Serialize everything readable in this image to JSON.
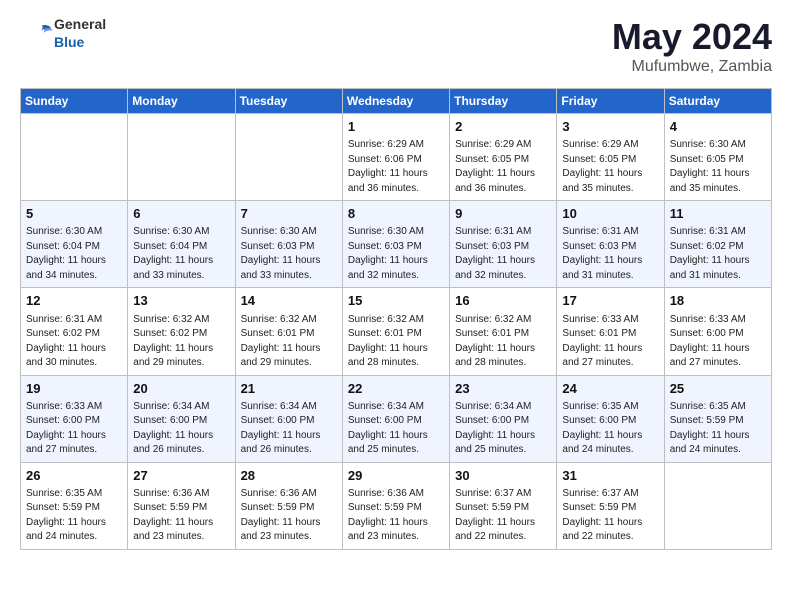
{
  "header": {
    "logo_general": "General",
    "logo_blue": "Blue",
    "month_year": "May 2024",
    "location": "Mufumbwe, Zambia"
  },
  "days_of_week": [
    "Sunday",
    "Monday",
    "Tuesday",
    "Wednesday",
    "Thursday",
    "Friday",
    "Saturday"
  ],
  "weeks": [
    {
      "row_class": "row-norm",
      "days": [
        {
          "num": "",
          "info": ""
        },
        {
          "num": "",
          "info": ""
        },
        {
          "num": "",
          "info": ""
        },
        {
          "num": "1",
          "info": "Sunrise: 6:29 AM\nSunset: 6:06 PM\nDaylight: 11 hours and 36 minutes."
        },
        {
          "num": "2",
          "info": "Sunrise: 6:29 AM\nSunset: 6:05 PM\nDaylight: 11 hours and 36 minutes."
        },
        {
          "num": "3",
          "info": "Sunrise: 6:29 AM\nSunset: 6:05 PM\nDaylight: 11 hours and 35 minutes."
        },
        {
          "num": "4",
          "info": "Sunrise: 6:30 AM\nSunset: 6:05 PM\nDaylight: 11 hours and 35 minutes."
        }
      ]
    },
    {
      "row_class": "row-alt",
      "days": [
        {
          "num": "5",
          "info": "Sunrise: 6:30 AM\nSunset: 6:04 PM\nDaylight: 11 hours and 34 minutes."
        },
        {
          "num": "6",
          "info": "Sunrise: 6:30 AM\nSunset: 6:04 PM\nDaylight: 11 hours and 33 minutes."
        },
        {
          "num": "7",
          "info": "Sunrise: 6:30 AM\nSunset: 6:03 PM\nDaylight: 11 hours and 33 minutes."
        },
        {
          "num": "8",
          "info": "Sunrise: 6:30 AM\nSunset: 6:03 PM\nDaylight: 11 hours and 32 minutes."
        },
        {
          "num": "9",
          "info": "Sunrise: 6:31 AM\nSunset: 6:03 PM\nDaylight: 11 hours and 32 minutes."
        },
        {
          "num": "10",
          "info": "Sunrise: 6:31 AM\nSunset: 6:03 PM\nDaylight: 11 hours and 31 minutes."
        },
        {
          "num": "11",
          "info": "Sunrise: 6:31 AM\nSunset: 6:02 PM\nDaylight: 11 hours and 31 minutes."
        }
      ]
    },
    {
      "row_class": "row-norm",
      "days": [
        {
          "num": "12",
          "info": "Sunrise: 6:31 AM\nSunset: 6:02 PM\nDaylight: 11 hours and 30 minutes."
        },
        {
          "num": "13",
          "info": "Sunrise: 6:32 AM\nSunset: 6:02 PM\nDaylight: 11 hours and 29 minutes."
        },
        {
          "num": "14",
          "info": "Sunrise: 6:32 AM\nSunset: 6:01 PM\nDaylight: 11 hours and 29 minutes."
        },
        {
          "num": "15",
          "info": "Sunrise: 6:32 AM\nSunset: 6:01 PM\nDaylight: 11 hours and 28 minutes."
        },
        {
          "num": "16",
          "info": "Sunrise: 6:32 AM\nSunset: 6:01 PM\nDaylight: 11 hours and 28 minutes."
        },
        {
          "num": "17",
          "info": "Sunrise: 6:33 AM\nSunset: 6:01 PM\nDaylight: 11 hours and 27 minutes."
        },
        {
          "num": "18",
          "info": "Sunrise: 6:33 AM\nSunset: 6:00 PM\nDaylight: 11 hours and 27 minutes."
        }
      ]
    },
    {
      "row_class": "row-alt",
      "days": [
        {
          "num": "19",
          "info": "Sunrise: 6:33 AM\nSunset: 6:00 PM\nDaylight: 11 hours and 27 minutes."
        },
        {
          "num": "20",
          "info": "Sunrise: 6:34 AM\nSunset: 6:00 PM\nDaylight: 11 hours and 26 minutes."
        },
        {
          "num": "21",
          "info": "Sunrise: 6:34 AM\nSunset: 6:00 PM\nDaylight: 11 hours and 26 minutes."
        },
        {
          "num": "22",
          "info": "Sunrise: 6:34 AM\nSunset: 6:00 PM\nDaylight: 11 hours and 25 minutes."
        },
        {
          "num": "23",
          "info": "Sunrise: 6:34 AM\nSunset: 6:00 PM\nDaylight: 11 hours and 25 minutes."
        },
        {
          "num": "24",
          "info": "Sunrise: 6:35 AM\nSunset: 6:00 PM\nDaylight: 11 hours and 24 minutes."
        },
        {
          "num": "25",
          "info": "Sunrise: 6:35 AM\nSunset: 5:59 PM\nDaylight: 11 hours and 24 minutes."
        }
      ]
    },
    {
      "row_class": "row-norm",
      "days": [
        {
          "num": "26",
          "info": "Sunrise: 6:35 AM\nSunset: 5:59 PM\nDaylight: 11 hours and 24 minutes."
        },
        {
          "num": "27",
          "info": "Sunrise: 6:36 AM\nSunset: 5:59 PM\nDaylight: 11 hours and 23 minutes."
        },
        {
          "num": "28",
          "info": "Sunrise: 6:36 AM\nSunset: 5:59 PM\nDaylight: 11 hours and 23 minutes."
        },
        {
          "num": "29",
          "info": "Sunrise: 6:36 AM\nSunset: 5:59 PM\nDaylight: 11 hours and 23 minutes."
        },
        {
          "num": "30",
          "info": "Sunrise: 6:37 AM\nSunset: 5:59 PM\nDaylight: 11 hours and 22 minutes."
        },
        {
          "num": "31",
          "info": "Sunrise: 6:37 AM\nSunset: 5:59 PM\nDaylight: 11 hours and 22 minutes."
        },
        {
          "num": "",
          "info": ""
        }
      ]
    }
  ]
}
